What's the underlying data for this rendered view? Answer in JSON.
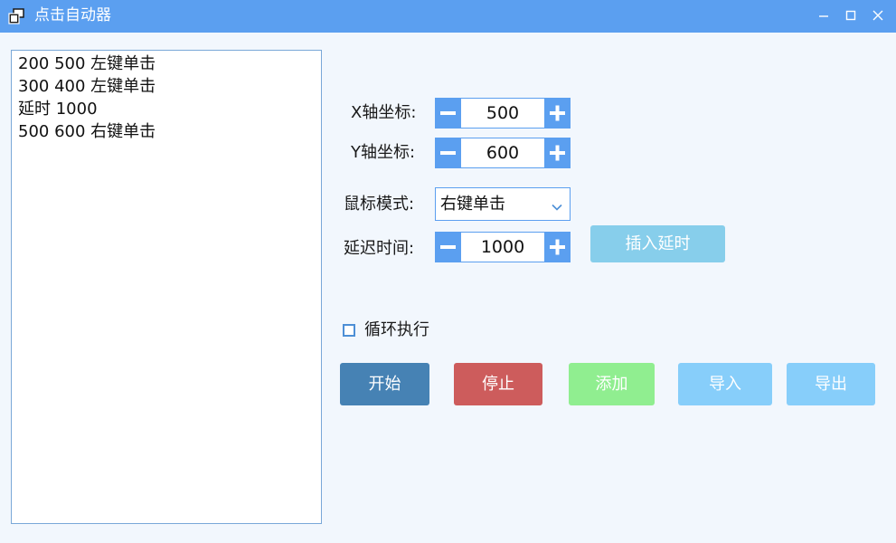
{
  "window": {
    "title": "点击自动器"
  },
  "script_list": {
    "items": [
      "200 500 左键单击",
      "300 400 左键单击",
      "延时 1000",
      "500 600 右键单击"
    ]
  },
  "controls": {
    "x_label": "X轴坐标:",
    "x_value": "500",
    "y_label": "Y轴坐标:",
    "y_value": "600",
    "mode_label": "鼠标模式:",
    "mode_value": "右键单击",
    "delay_label": "延迟时间:",
    "delay_value": "1000",
    "insert_delay_label": "插入延时",
    "loop_label": "循环执行",
    "loop_checked": false
  },
  "buttons": {
    "start": "开始",
    "stop": "停止",
    "add": "添加",
    "import": "导入",
    "export": "导出"
  },
  "colors": {
    "titlebar": "#5b9ff0",
    "accent": "#5b9ff0",
    "start": "#4682b4",
    "stop": "#cd5c5c",
    "add": "#90ee90",
    "import_export": "#87cefa",
    "insert_delay": "#87ceeb"
  }
}
